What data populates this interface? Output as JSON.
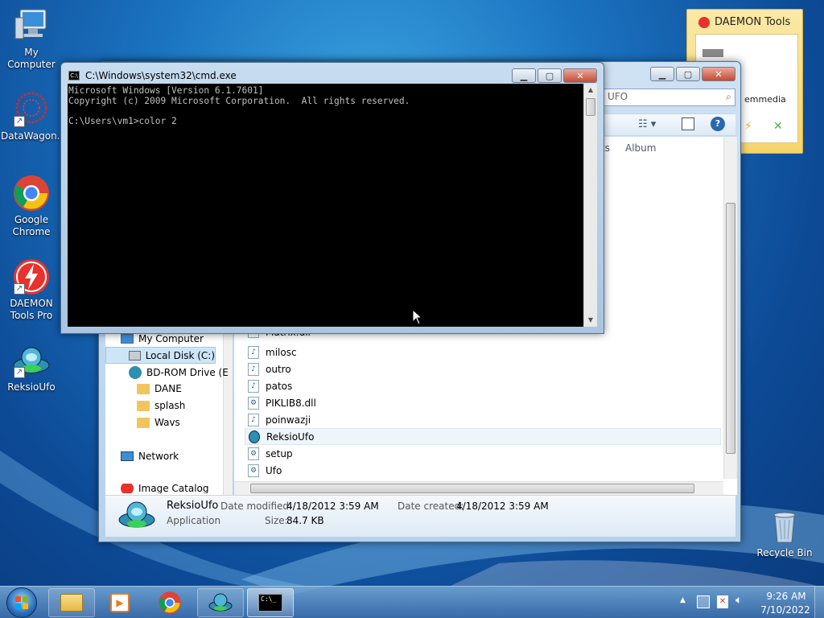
{
  "desktop": {
    "icons": [
      {
        "label": "My Computer"
      },
      {
        "label": "DataWagon..."
      },
      {
        "label": "Google Chrome"
      },
      {
        "label": "DAEMON Tools Pro"
      },
      {
        "label": "ReksioUfo"
      },
      {
        "label": "Recycle Bin"
      }
    ]
  },
  "daemon_gadget": {
    "title": "DAEMON Tools",
    "item_label": "emmedia"
  },
  "explorer": {
    "search_placeholder": "UFO",
    "column_partial": "ts",
    "column_album": "Album",
    "nav": {
      "my_computer": "My Computer",
      "local_disk": "Local Disk (C:)",
      "bd_rom": "BD-ROM Drive (E",
      "dane": "DANE",
      "splash": "splash",
      "wavs": "Wavs",
      "network": "Network",
      "image_catalog": "Image Catalog"
    },
    "files": [
      {
        "name": "Matrix.dll",
        "type": "dll"
      },
      {
        "name": "milosc",
        "type": "audio"
      },
      {
        "name": "outro",
        "type": "audio"
      },
      {
        "name": "patos",
        "type": "audio"
      },
      {
        "name": "PIKLIB8.dll",
        "type": "dll"
      },
      {
        "name": "poinwazji",
        "type": "audio"
      },
      {
        "name": "ReksioUfo",
        "type": "app"
      },
      {
        "name": "setup",
        "type": "setup"
      },
      {
        "name": "Ufo",
        "type": "setup"
      }
    ],
    "details": {
      "name": "ReksioUfo",
      "type": "Application",
      "modified_label": "Date modified:",
      "modified_value": "4/18/2012 3:59 AM",
      "created_label": "Date created:",
      "created_value": "4/18/2012 3:59 AM",
      "size_label": "Size:",
      "size_value": "84.7 KB"
    }
  },
  "cmd": {
    "title": "C:\\Windows\\system32\\cmd.exe",
    "line1": "Microsoft Windows [Version 6.1.7601]",
    "line2": "Copyright (c) 2009 Microsoft Corporation.  All rights reserved.",
    "line3": "",
    "line4": "C:\\Users\\vm1>color 2"
  },
  "taskbar": {
    "icons": [
      "start-orb",
      "explorer",
      "media-player",
      "chrome",
      "reksioufo",
      "cmd"
    ],
    "time": "9:26 AM",
    "date": "7/10/2022"
  },
  "colors": {
    "cmd_bg": "#000000",
    "cmd_text": "#c0c0c0",
    "desktop_blue": "#1b73c0"
  }
}
